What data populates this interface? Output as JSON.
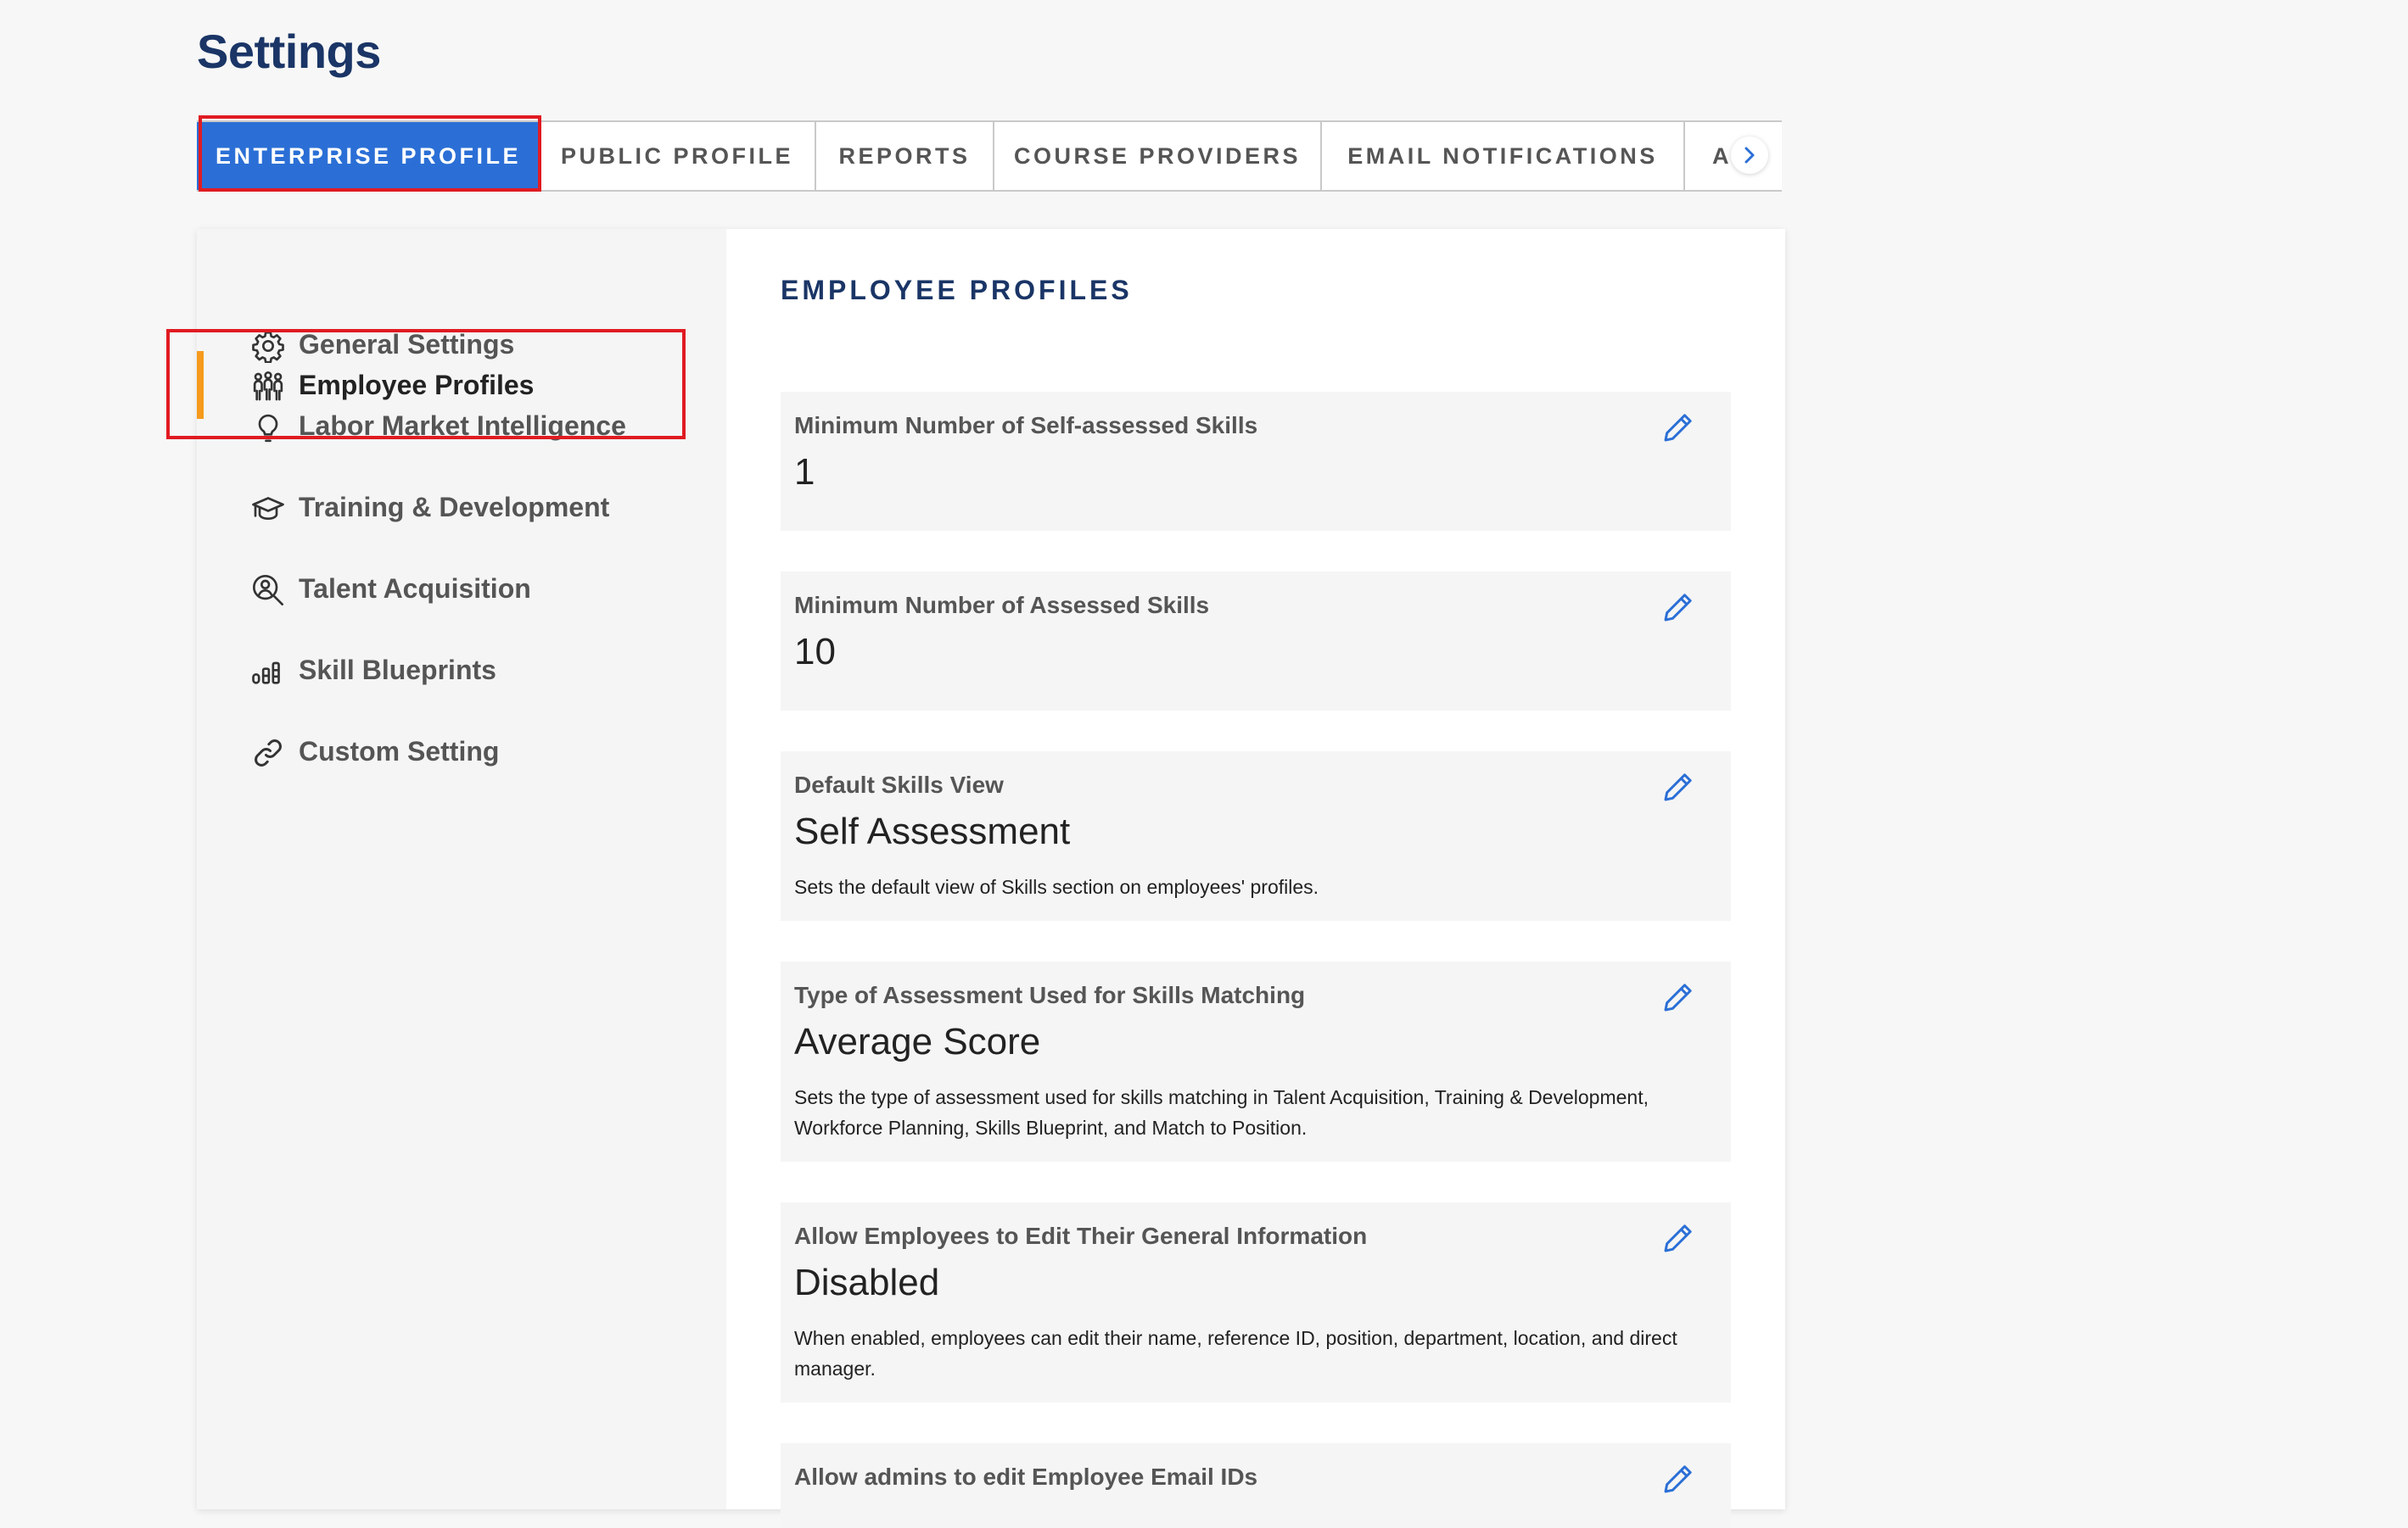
{
  "page": {
    "title": "Settings"
  },
  "tabs": [
    {
      "label": "ENTERPRISE PROFILE",
      "active": true
    },
    {
      "label": "PUBLIC PROFILE"
    },
    {
      "label": "REPORTS"
    },
    {
      "label": "COURSE PROVIDERS"
    },
    {
      "label": "EMAIL NOTIFICATIONS"
    },
    {
      "label": "A"
    }
  ],
  "tab_scroll_icon": "chevron-right-icon",
  "sidebar": {
    "items": [
      {
        "label": "General Settings",
        "icon": "gear-icon"
      },
      {
        "label": "Employee Profiles",
        "icon": "people-icon",
        "active": true
      },
      {
        "label": "Labor Market Intelligence",
        "icon": "lightbulb-icon"
      },
      {
        "label": "Training & Development",
        "icon": "graduation-cap-icon"
      },
      {
        "label": "Talent Acquisition",
        "icon": "person-search-icon"
      },
      {
        "label": "Skill Blueprints",
        "icon": "skill-bars-icon"
      },
      {
        "label": "Custom Setting",
        "icon": "link-icon"
      }
    ]
  },
  "content": {
    "section_title": "EMPLOYEE PROFILES",
    "fields": [
      {
        "label": "Minimum Number of Self-assessed Skills",
        "value": "1"
      },
      {
        "label": "Minimum Number of Assessed Skills",
        "value": "10"
      },
      {
        "label": "Default Skills View",
        "value": "Self Assessment",
        "description": "Sets the default view of Skills section on employees' profiles."
      },
      {
        "label": "Type of Assessment Used for Skills Matching",
        "value": "Average Score",
        "description": "Sets the type of assessment used for skills matching in Talent Acquisition, Training & Development, Workforce Planning, Skills Blueprint, and Match to Position."
      },
      {
        "label": "Allow Employees to Edit Their General Information",
        "value": "Disabled",
        "description": "When enabled, employees can edit their name, reference ID, position, department, location, and direct manager."
      },
      {
        "label": "Allow admins to edit Employee Email IDs"
      }
    ]
  },
  "colors": {
    "primary": "#2b6fd6",
    "title": "#1a3566",
    "active_indicator": "#f59a1c",
    "highlight": "#e01b22"
  }
}
